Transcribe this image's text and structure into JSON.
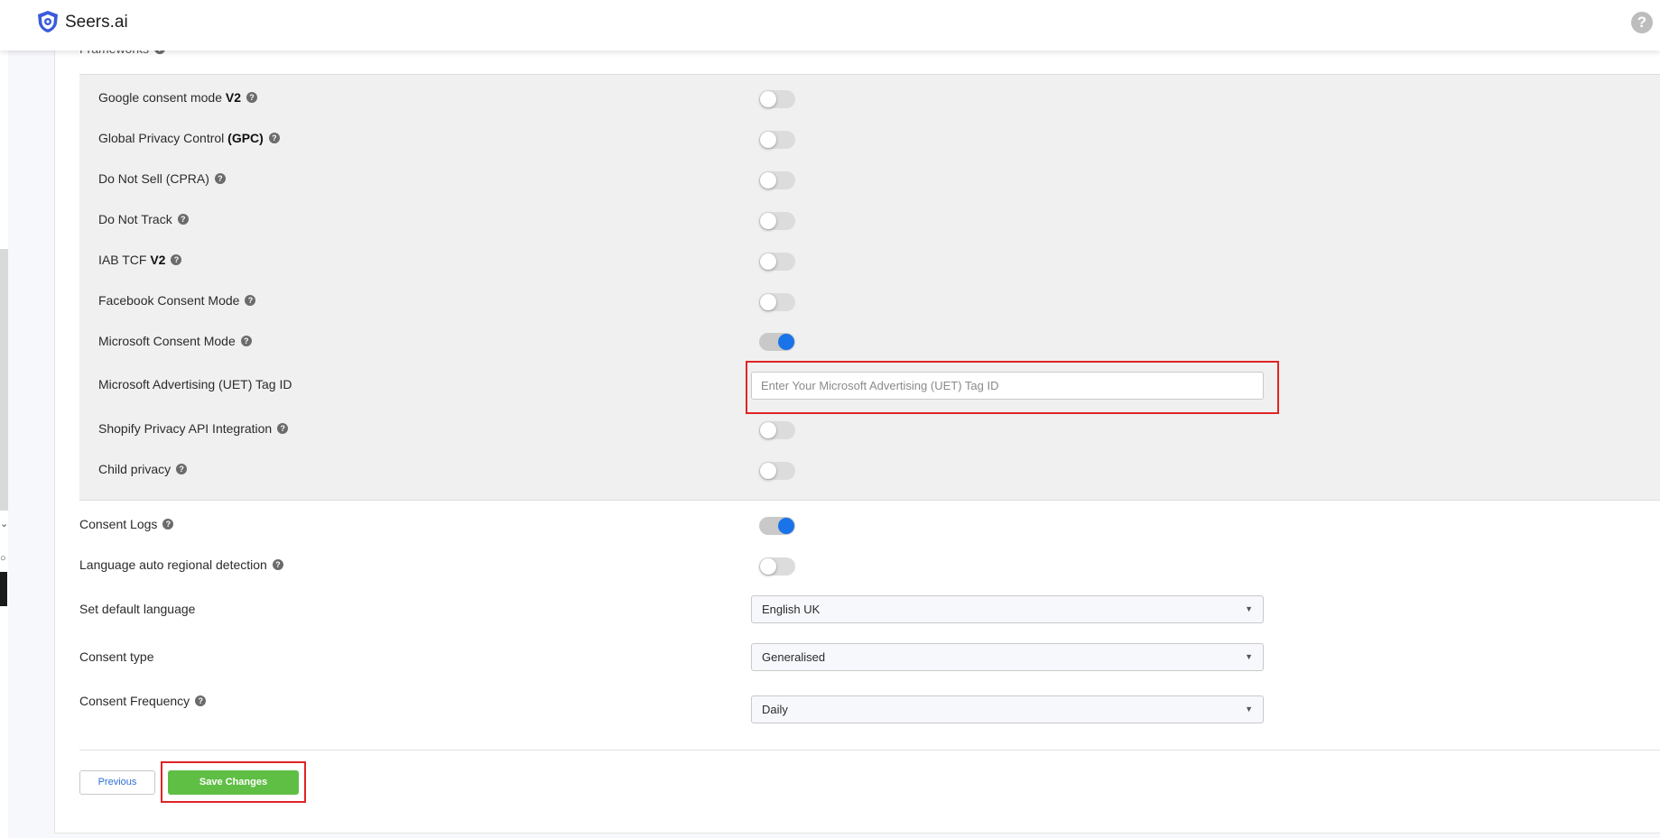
{
  "app": {
    "title": "Seers.ai",
    "help_glyph": "?"
  },
  "section": {
    "label": "Frameworks"
  },
  "frameworks": [
    {
      "pre": "Google consent mode ",
      "bold": "V2",
      "post": "",
      "help": true,
      "enabled": false
    },
    {
      "pre": "Global Privacy Control ",
      "bold": "(GPC)",
      "post": "",
      "help": true,
      "enabled": false
    },
    {
      "pre": "Do Not Sell (CPRA)",
      "bold": "",
      "post": "",
      "help": true,
      "enabled": false
    },
    {
      "pre": "Do Not Track",
      "bold": "",
      "post": "",
      "help": true,
      "enabled": false
    },
    {
      "pre": "IAB TCF ",
      "bold": "V2",
      "post": "",
      "help": true,
      "enabled": false
    },
    {
      "pre": "Facebook Consent Mode",
      "bold": "",
      "post": "",
      "help": true,
      "enabled": false
    },
    {
      "pre": "Microsoft Consent Mode",
      "bold": "",
      "post": "",
      "help": true,
      "enabled": true
    }
  ],
  "uet": {
    "label": "Microsoft Advertising (UET) Tag ID",
    "value": "",
    "placeholder": "Enter Your Microsoft Advertising (UET) Tag ID"
  },
  "frameworks_after": [
    {
      "pre": "Shopify Privacy API Integration",
      "bold": "",
      "post": "",
      "help": true,
      "enabled": false
    },
    {
      "pre": "Child privacy",
      "bold": "",
      "post": "",
      "help": true,
      "enabled": false
    }
  ],
  "settings": [
    {
      "label": "Consent Logs",
      "help": true,
      "enabled": true
    },
    {
      "label": "Language auto regional detection",
      "help": true,
      "enabled": false
    }
  ],
  "selects": [
    {
      "label": "Set default language",
      "help": false,
      "value": "English UK"
    },
    {
      "label": "Consent type",
      "help": false,
      "value": "Generalised"
    },
    {
      "label": "Consent Frequency",
      "help": true,
      "value": "Daily"
    }
  ],
  "buttons": {
    "previous": "Previous",
    "save": "Save Changes"
  },
  "colors": {
    "accent": "#1a73e8",
    "save": "#5fbf45",
    "highlight": "#e02424",
    "link": "#2f6fd6"
  }
}
